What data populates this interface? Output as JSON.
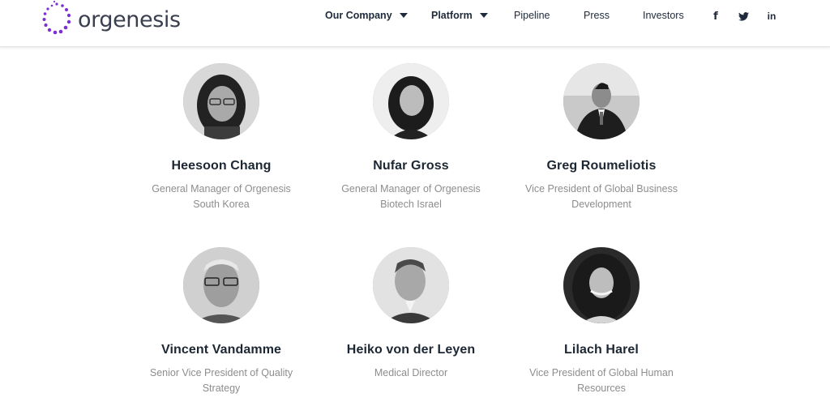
{
  "brand": {
    "name": "orgenesis",
    "logo_color": "#7b2fd6"
  },
  "nav": {
    "items": [
      {
        "label": "Our Company",
        "has_dropdown": true
      },
      {
        "label": "Platform",
        "has_dropdown": true
      },
      {
        "label": "Pipeline",
        "has_dropdown": false
      },
      {
        "label": "Press",
        "has_dropdown": false
      },
      {
        "label": "Investors",
        "has_dropdown": false
      }
    ],
    "social": [
      {
        "icon": "facebook-icon",
        "glyph": "f"
      },
      {
        "icon": "twitter-icon",
        "glyph": "🐦"
      },
      {
        "icon": "linkedin-icon",
        "glyph": "in"
      }
    ]
  },
  "team": [
    {
      "name": "Heesoon Chang",
      "role_line1": "General Manager of Orgenesis",
      "role_line2": "South Korea"
    },
    {
      "name": "Nufar Gross",
      "role_line1": "General Manager of Orgenesis",
      "role_line2": "Biotech Israel"
    },
    {
      "name": "Greg Roumeliotis",
      "role_line1": "Vice President of Global Business",
      "role_line2": "Development"
    },
    {
      "name": "Vincent Vandamme",
      "role_line1": "Senior Vice President of Quality",
      "role_line2": "Strategy"
    },
    {
      "name": "Heiko von der Leyen",
      "role_line1": "Medical Director",
      "role_line2": ""
    },
    {
      "name": "Lilach Harel",
      "role_line1": "Vice President of Global Human",
      "role_line2": "Resources"
    }
  ]
}
